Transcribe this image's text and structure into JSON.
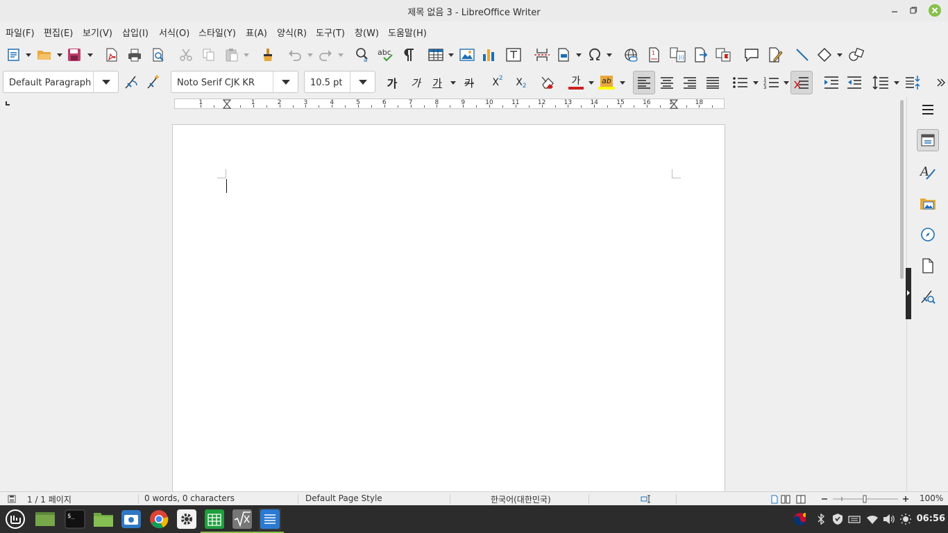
{
  "window": {
    "title": "제목 없음 3 - LibreOffice Writer"
  },
  "menu": {
    "items": [
      "파일(F)",
      "편집(E)",
      "보기(V)",
      "삽입(I)",
      "서식(O)",
      "스타일(Y)",
      "표(A)",
      "양식(R)",
      "도구(T)",
      "창(W)",
      "도움말(H)"
    ]
  },
  "formatting": {
    "paragraph_style": "Default Paragraph",
    "font_name": "Noto Serif CJK KR",
    "font_size": "10.5 pt",
    "bold_glyph": "가",
    "italic_glyph": "가",
    "underline_glyph": "가",
    "strike_glyph": "카",
    "superscript_glyph": "X",
    "superscript_mark": "2",
    "subscript_glyph": "X",
    "subscript_mark": "2",
    "font_color_glyph": "가",
    "highlight_glyph": "ab",
    "font_color": "#c9211e",
    "highlight_color": "#ffff00"
  },
  "ruler": {
    "labels": [
      "1",
      "1",
      "2",
      "3",
      "4",
      "5",
      "6",
      "7",
      "8",
      "9",
      "10",
      "11",
      "12",
      "13",
      "14",
      "15",
      "16",
      "17",
      "18"
    ]
  },
  "statusbar": {
    "page": "1 / 1 페이지",
    "word_count": "0 words, 0 characters",
    "page_style": "Default Page Style",
    "language": "한국어(대한민국)",
    "zoom": "100%"
  },
  "taskbar": {
    "clock": "06:56",
    "apps": [
      "menu-icon",
      "show-desktop-icon",
      "terminal-icon",
      "files-icon",
      "screenshot-icon",
      "chrome-icon",
      "settings-icon",
      "calc-icon",
      "math-icon",
      "writer-icon"
    ]
  },
  "colors": {
    "accent": "#1e6fb4",
    "close_button": "#87c04a"
  }
}
